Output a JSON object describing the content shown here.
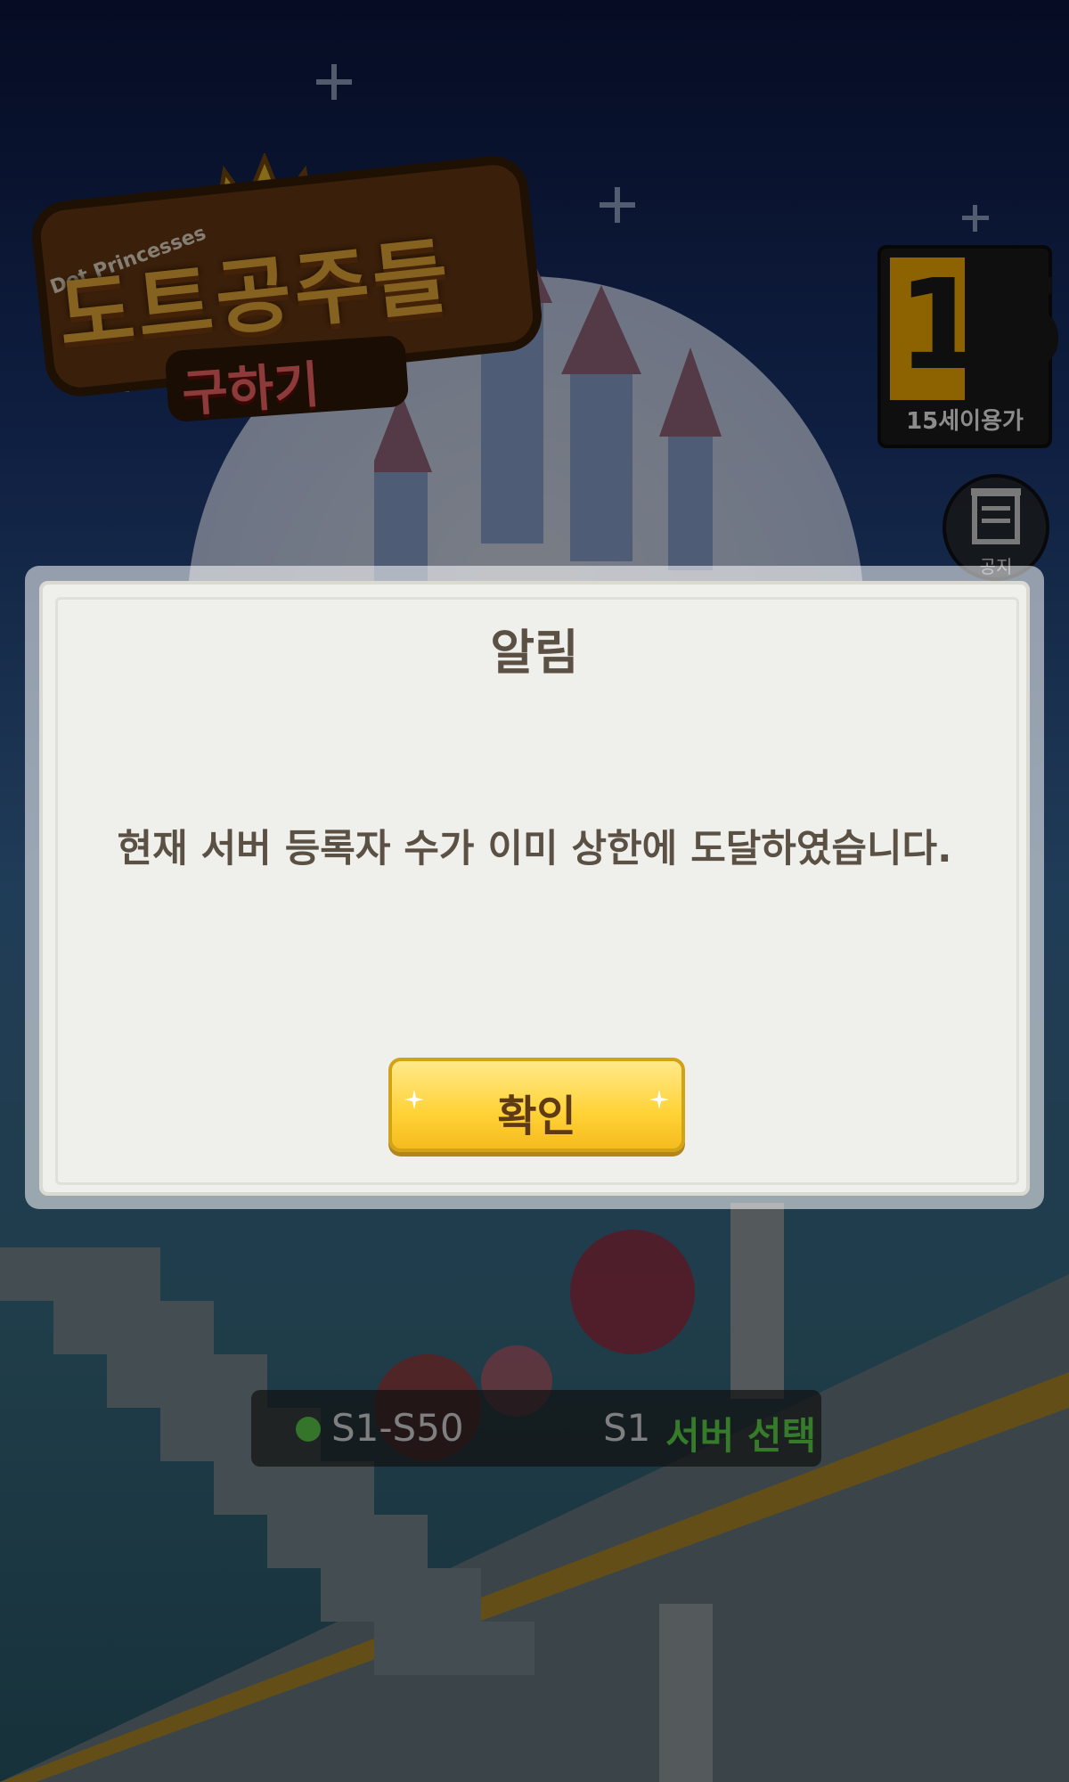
{
  "app": {
    "logo_latin": "Dot Princesses",
    "logo_main": "도트공주들",
    "logo_sub": "구하기"
  },
  "age_rating": {
    "number": "15",
    "label": "15세이용가"
  },
  "notice_button": {
    "label": "공지"
  },
  "server_bar": {
    "range": "S1-S50",
    "current": "S1",
    "select_label": "서버 선택",
    "status_color": "#5fd34f"
  },
  "dialog": {
    "title": "알림",
    "message": "현재 서버 등록자 수가 이미 상한에 도달하였습니다.",
    "confirm_label": "확인"
  }
}
